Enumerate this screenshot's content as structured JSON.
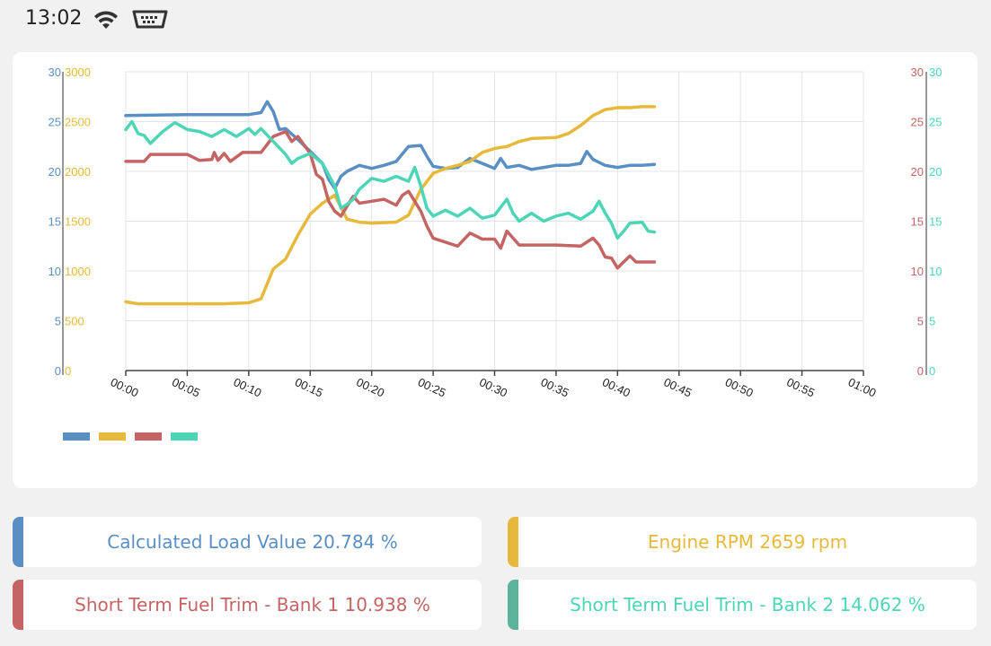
{
  "status": {
    "time": "13:02",
    "icons": [
      "wifi-icon",
      "obd-connector-icon"
    ]
  },
  "colors": {
    "load": "#5a8fc4",
    "rpm": "#e6b93c",
    "stft1": "#c46464",
    "stft2": "#4dd5b6"
  },
  "chart_data": {
    "type": "line",
    "x_ticks": [
      "00:00",
      "00:05",
      "00:10",
      "00:15",
      "00:20",
      "00:25",
      "00:30",
      "00:35",
      "00:40",
      "00:45",
      "00:50",
      "00:55",
      "01:00"
    ],
    "xlim": [
      "00:00",
      "01:00"
    ],
    "axes": {
      "left_outer": {
        "ticks": [
          "30",
          "25",
          "20",
          "15",
          "10",
          "5",
          "0"
        ],
        "range": [
          0,
          30
        ],
        "color": "#5a8fc4"
      },
      "left_inner": {
        "ticks": [
          "3000",
          "2500",
          "2000",
          "1500",
          "1000",
          "500",
          "0"
        ],
        "range": [
          0,
          3000
        ],
        "color": "#e6b93c"
      },
      "right_inner": {
        "ticks": [
          "30",
          "25",
          "20",
          "15",
          "10",
          "5",
          "0"
        ],
        "range": [
          0,
          30
        ],
        "color": "#c46464"
      },
      "right_outer": {
        "ticks": [
          "30",
          "25",
          "20",
          "15",
          "10",
          "5",
          "0"
        ],
        "range": [
          0,
          30
        ],
        "color": "#4dd5b6"
      }
    },
    "grid": true,
    "legend": "bottom-left",
    "series": [
      {
        "key": "load",
        "axis": "left_outer",
        "color": "#5a8fc4",
        "points": [
          [
            "00:00",
            25.6
          ],
          [
            "00:05",
            25.7
          ],
          [
            "00:10",
            25.7
          ],
          [
            "00:11",
            25.9
          ],
          [
            "00:11.5",
            27.0
          ],
          [
            "00:12",
            26.0
          ],
          [
            "00:12.5",
            24.2
          ],
          [
            "00:13",
            24.3
          ],
          [
            "00:14",
            23.2
          ],
          [
            "00:15",
            22.0
          ],
          [
            "00:16",
            20.8
          ],
          [
            "00:16.5",
            19.2
          ],
          [
            "00:17",
            18.3
          ],
          [
            "00:17.5",
            19.5
          ],
          [
            "00:18",
            20.0
          ],
          [
            "00:19",
            20.6
          ],
          [
            "00:20",
            20.3
          ],
          [
            "00:21",
            20.6
          ],
          [
            "00:22",
            21.0
          ],
          [
            "00:23",
            22.5
          ],
          [
            "00:24",
            22.6
          ],
          [
            "00:24.5",
            21.5
          ],
          [
            "00:25",
            20.5
          ],
          [
            "00:26",
            20.3
          ],
          [
            "00:27",
            20.4
          ],
          [
            "00:28",
            21.3
          ],
          [
            "00:29",
            20.8
          ],
          [
            "00:30",
            20.3
          ],
          [
            "00:30.5",
            21.3
          ],
          [
            "00:31",
            20.4
          ],
          [
            "00:32",
            20.6
          ],
          [
            "00:33",
            20.2
          ],
          [
            "00:34",
            20.4
          ],
          [
            "00:35",
            20.6
          ],
          [
            "00:36",
            20.6
          ],
          [
            "00:37",
            20.8
          ],
          [
            "00:37.5",
            22.0
          ],
          [
            "00:38",
            21.2
          ],
          [
            "00:39",
            20.6
          ],
          [
            "00:40",
            20.4
          ],
          [
            "00:41",
            20.6
          ],
          [
            "00:42",
            20.6
          ],
          [
            "00:43",
            20.7
          ]
        ]
      },
      {
        "key": "rpm",
        "axis": "left_inner",
        "color": "#e6b93c",
        "points": [
          [
            "00:00",
            690
          ],
          [
            "00:01",
            670
          ],
          [
            "00:03",
            670
          ],
          [
            "00:05",
            670
          ],
          [
            "00:08",
            670
          ],
          [
            "00:10",
            680
          ],
          [
            "00:11",
            720
          ],
          [
            "00:12",
            1020
          ],
          [
            "00:13",
            1120
          ],
          [
            "00:14",
            1360
          ],
          [
            "00:15",
            1570
          ],
          [
            "00:16",
            1680
          ],
          [
            "00:17",
            1760
          ],
          [
            "00:18",
            1520
          ],
          [
            "00:19",
            1490
          ],
          [
            "00:20",
            1480
          ],
          [
            "00:22",
            1490
          ],
          [
            "00:23",
            1560
          ],
          [
            "00:24",
            1820
          ],
          [
            "00:25",
            1980
          ],
          [
            "00:26",
            2030
          ],
          [
            "00:27",
            2060
          ],
          [
            "00:28",
            2100
          ],
          [
            "00:29",
            2190
          ],
          [
            "00:30",
            2230
          ],
          [
            "00:31",
            2250
          ],
          [
            "00:32",
            2300
          ],
          [
            "00:33",
            2330
          ],
          [
            "00:35",
            2340
          ],
          [
            "00:36",
            2380
          ],
          [
            "00:37",
            2460
          ],
          [
            "00:38",
            2560
          ],
          [
            "00:39",
            2620
          ],
          [
            "00:40",
            2640
          ],
          [
            "00:41",
            2640
          ],
          [
            "00:42",
            2650
          ],
          [
            "00:43",
            2650
          ]
        ]
      },
      {
        "key": "stft1",
        "axis": "right_inner",
        "color": "#c46464",
        "points": [
          [
            "00:00",
            21.0
          ],
          [
            "00:01.5",
            21.0
          ],
          [
            "00:02",
            21.7
          ],
          [
            "00:05",
            21.7
          ],
          [
            "00:06",
            21.1
          ],
          [
            "00:07",
            21.2
          ],
          [
            "00:07.2",
            21.9
          ],
          [
            "00:07.5",
            21.1
          ],
          [
            "00:08",
            21.8
          ],
          [
            "00:08.5",
            21.0
          ],
          [
            "00:09.5",
            21.9
          ],
          [
            "00:11",
            21.9
          ],
          [
            "00:12",
            23.5
          ],
          [
            "00:13",
            24.0
          ],
          [
            "00:13.5",
            23.0
          ],
          [
            "00:14",
            23.5
          ],
          [
            "00:15",
            21.8
          ],
          [
            "00:15.5",
            19.7
          ],
          [
            "00:16",
            19.2
          ],
          [
            "00:16.5",
            17.0
          ],
          [
            "00:17",
            16.0
          ],
          [
            "00:17.5",
            15.5
          ],
          [
            "00:18",
            16.5
          ],
          [
            "00:18.5",
            17.5
          ],
          [
            "00:19",
            16.8
          ],
          [
            "00:20",
            17.0
          ],
          [
            "00:21",
            17.2
          ],
          [
            "00:22",
            16.6
          ],
          [
            "00:22.5",
            17.6
          ],
          [
            "00:23",
            18.0
          ],
          [
            "00:24",
            16.0
          ],
          [
            "00:24.5",
            14.5
          ],
          [
            "00:25",
            13.3
          ],
          [
            "00:27",
            12.5
          ],
          [
            "00:28",
            13.8
          ],
          [
            "00:29",
            13.2
          ],
          [
            "00:30",
            13.2
          ],
          [
            "00:30.5",
            12.3
          ],
          [
            "00:31",
            14.0
          ],
          [
            "00:32",
            12.6
          ],
          [
            "00:35",
            12.6
          ],
          [
            "00:37",
            12.5
          ],
          [
            "00:38",
            13.3
          ],
          [
            "00:38.5",
            12.6
          ],
          [
            "00:39",
            11.4
          ],
          [
            "00:39.5",
            11.3
          ],
          [
            "00:40",
            10.3
          ],
          [
            "00:41",
            11.5
          ],
          [
            "00:41.5",
            10.9
          ],
          [
            "00:43",
            10.9
          ]
        ]
      },
      {
        "key": "stft2",
        "axis": "right_outer",
        "color": "#4dd5b6",
        "points": [
          [
            "00:00",
            24.2
          ],
          [
            "00:00.5",
            25.0
          ],
          [
            "00:01",
            23.8
          ],
          [
            "00:01.5",
            23.6
          ],
          [
            "00:02",
            22.8
          ],
          [
            "00:02.5",
            23.4
          ],
          [
            "00:03",
            24.0
          ],
          [
            "00:04",
            24.9
          ],
          [
            "00:05",
            24.2
          ],
          [
            "00:06",
            24.0
          ],
          [
            "00:07",
            23.5
          ],
          [
            "00:08",
            24.2
          ],
          [
            "00:09",
            23.5
          ],
          [
            "00:10",
            24.3
          ],
          [
            "00:10.5",
            23.7
          ],
          [
            "00:11",
            24.3
          ],
          [
            "00:12",
            23.0
          ],
          [
            "00:13",
            21.7
          ],
          [
            "00:13.5",
            20.8
          ],
          [
            "00:14",
            21.3
          ],
          [
            "00:15",
            21.8
          ],
          [
            "00:16",
            20.8
          ],
          [
            "00:17",
            18.5
          ],
          [
            "00:17.5",
            16.3
          ],
          [
            "00:18",
            16.7
          ],
          [
            "00:18.5",
            17.2
          ],
          [
            "00:19",
            18.2
          ],
          [
            "00:20",
            19.3
          ],
          [
            "00:21",
            19.0
          ],
          [
            "00:22",
            19.5
          ],
          [
            "00:23",
            19.0
          ],
          [
            "00:23.5",
            20.4
          ],
          [
            "00:24",
            18.5
          ],
          [
            "00:24.5",
            16.3
          ],
          [
            "00:25",
            15.5
          ],
          [
            "00:26",
            16.1
          ],
          [
            "00:27",
            15.5
          ],
          [
            "00:28",
            16.3
          ],
          [
            "00:29",
            15.3
          ],
          [
            "00:30",
            15.6
          ],
          [
            "00:31",
            17.2
          ],
          [
            "00:31.5",
            15.8
          ],
          [
            "00:32",
            15.0
          ],
          [
            "00:33",
            15.8
          ],
          [
            "00:34",
            15.0
          ],
          [
            "00:35",
            15.5
          ],
          [
            "00:36",
            15.8
          ],
          [
            "00:37",
            15.2
          ],
          [
            "00:38",
            16.0
          ],
          [
            "00:38.5",
            17.0
          ],
          [
            "00:39",
            15.8
          ],
          [
            "00:39.5",
            14.8
          ],
          [
            "00:40",
            13.3
          ],
          [
            "00:40.5",
            14.0
          ],
          [
            "00:41",
            14.8
          ],
          [
            "00:42",
            14.9
          ],
          [
            "00:42.5",
            14.0
          ],
          [
            "00:43",
            13.9
          ]
        ]
      }
    ]
  },
  "cards": [
    {
      "key": "load",
      "label": "Calculated Load Value 20.784 %",
      "color": "#5a8fc4"
    },
    {
      "key": "rpm",
      "label": "Engine RPM 2659 rpm",
      "color": "#e6b93c"
    },
    {
      "key": "stft1",
      "label": "Short Term Fuel Trim - Bank 1 10.938 %",
      "color": "#c46464"
    },
    {
      "key": "stft2",
      "label": "Short Term Fuel Trim - Bank 2 14.062 %",
      "color": "#4dd5b6",
      "bar_color": "#5bb49a"
    }
  ]
}
